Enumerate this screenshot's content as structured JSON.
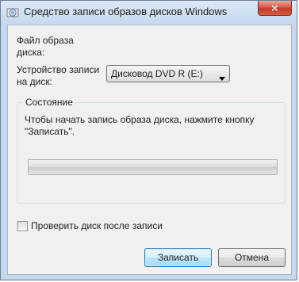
{
  "window": {
    "title": "Средство записи образов дисков Windows",
    "close_symbol": "✕"
  },
  "form": {
    "image_file_label_line1": "Файл образа",
    "image_file_label_line2": "диска:",
    "device_label_line1": "Устройство записи",
    "device_label_line2": "на диск:",
    "device_selected": "Дисковод DVD R (E:)"
  },
  "status_group": {
    "title": "Состояние",
    "message_line1": "Чтобы начать запись образа диска, нажмите кнопку",
    "message_line2": "\"Записать\".",
    "progress_percent": 0
  },
  "verify_checkbox": {
    "label": "Проверить диск после записи",
    "checked": false
  },
  "buttons": {
    "burn": "Записать",
    "cancel": "Отмена"
  },
  "colors": {
    "close_button": "#c43b2a",
    "primary_button_border": "#3c7fb1"
  },
  "icons": {
    "app": "disc-burner-icon",
    "combo": "chevron-down-icon"
  }
}
